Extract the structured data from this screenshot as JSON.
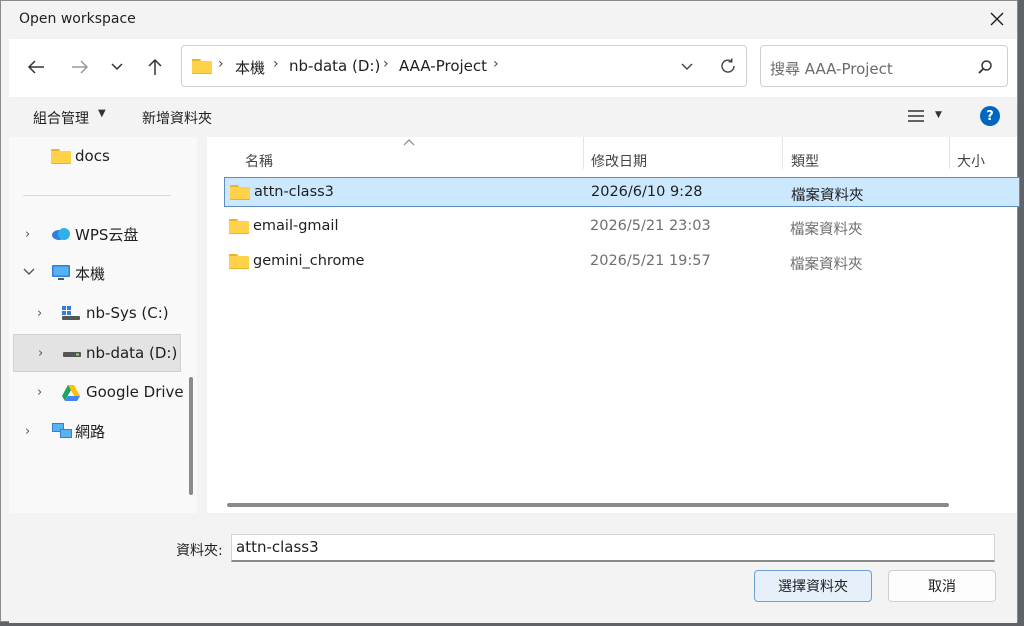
{
  "window": {
    "title": "Open workspace"
  },
  "nav": {
    "breadcrumb": [
      "本機",
      "nb-data (D:)",
      "AAA-Project"
    ],
    "search_placeholder": "搜尋 AAA-Project"
  },
  "toolbar": {
    "organize_label": "組合管理",
    "new_folder_label": "新增資料夾"
  },
  "sidebar": {
    "items": [
      {
        "label": "docs",
        "icon": "folder-icon"
      },
      {
        "label": "WPS云盘",
        "icon": "cloud-icon"
      },
      {
        "label": "本機",
        "icon": "computer-icon"
      },
      {
        "label": "nb-Sys (C:)",
        "icon": "drive-icon"
      },
      {
        "label": "nb-data (D:)",
        "icon": "drive-icon"
      },
      {
        "label": "Google Drive",
        "icon": "google-drive-icon"
      },
      {
        "label": "網路",
        "icon": "network-icon"
      }
    ]
  },
  "file_list": {
    "columns": [
      "名稱",
      "修改日期",
      "類型",
      "大小"
    ],
    "rows": [
      {
        "name": "attn-class3",
        "modified": "2026/6/10 9:28",
        "type": "檔案資料夾",
        "size": ""
      },
      {
        "name": "email-gmail",
        "modified": "2026/5/21 23:03",
        "type": "檔案資料夾",
        "size": ""
      },
      {
        "name": "gemini_chrome",
        "modified": "2026/5/21 19:57",
        "type": "檔案資料夾",
        "size": ""
      }
    ]
  },
  "footer": {
    "folder_label": "資料夾:",
    "folder_value": "attn-class3",
    "select_button": "選擇資料夾",
    "cancel_button": "取消"
  },
  "colors": {
    "selection": "#cce8ff",
    "accent": "#0067c0",
    "folder": "#ffd24a"
  }
}
